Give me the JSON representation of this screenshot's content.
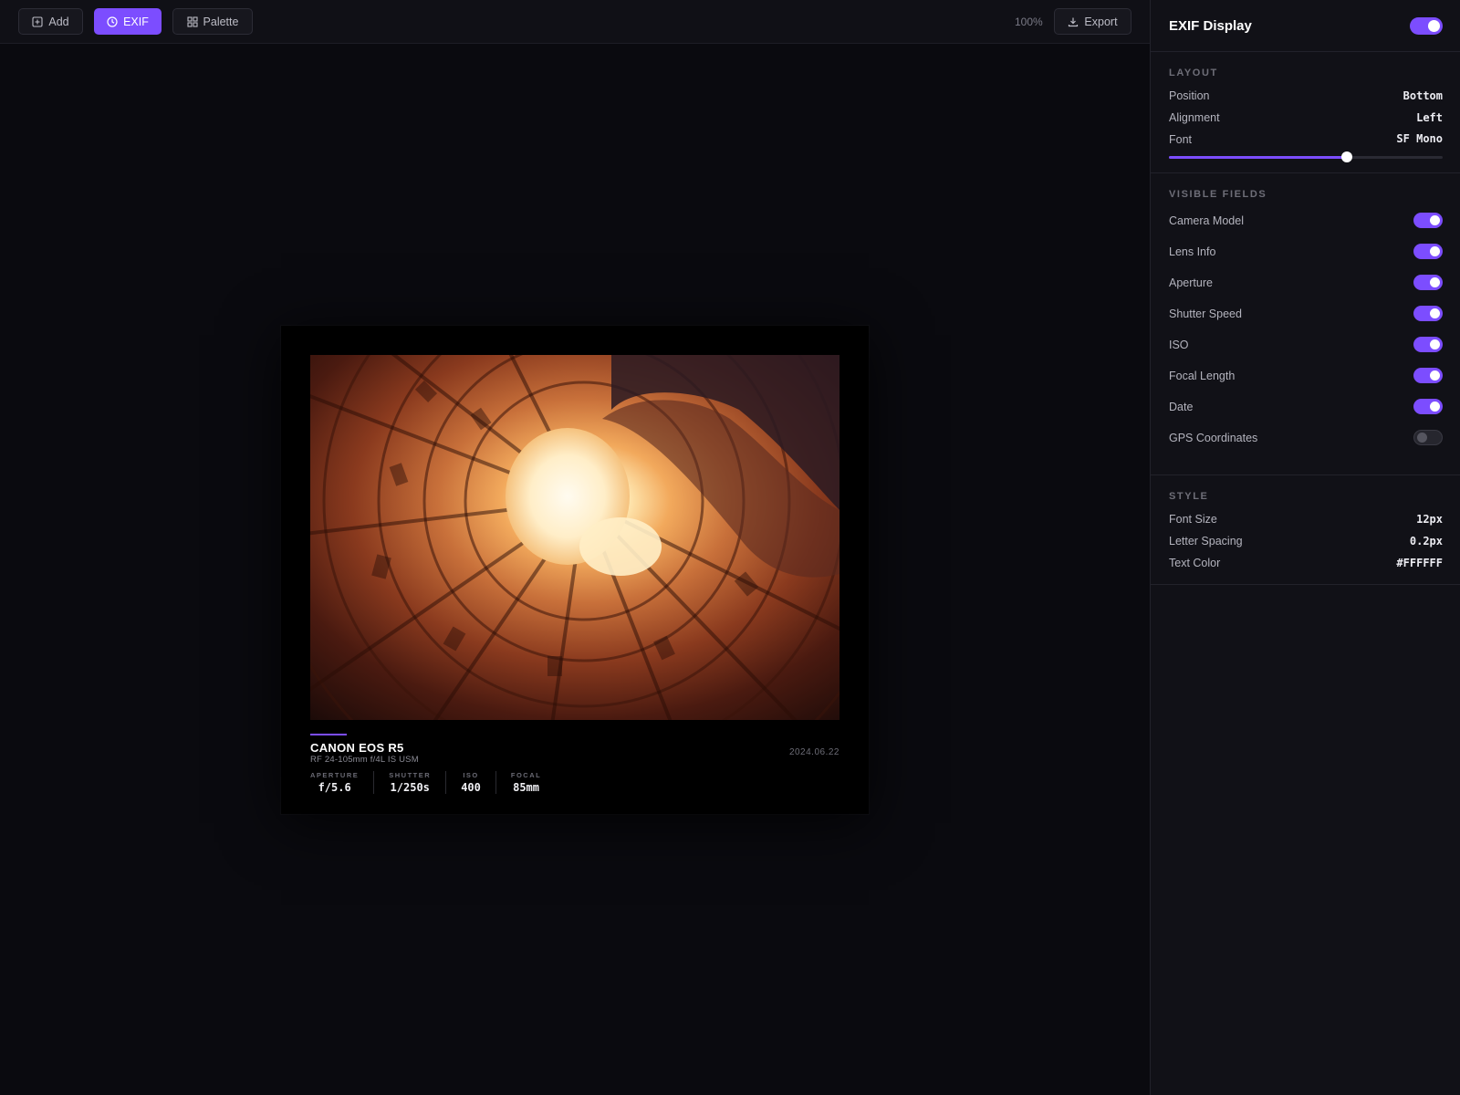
{
  "toolbar": {
    "add_label": "Add",
    "exif_label": "EXIF",
    "palette_label": "Palette",
    "zoom": "100%",
    "export_label": "Export"
  },
  "card": {
    "camera": "CANON EOS R5",
    "lens": "RF 24-105mm f/4L IS USM",
    "date": "2024.06.22",
    "stats": [
      {
        "label": "APERTURE",
        "value": "f/5.6"
      },
      {
        "label": "SHUTTER",
        "value": "1/250s"
      },
      {
        "label": "ISO",
        "value": "400"
      },
      {
        "label": "FOCAL",
        "value": "85mm"
      }
    ]
  },
  "sidebar": {
    "title": "EXIF Display",
    "enabled": true,
    "layout": {
      "title": "LAYOUT",
      "position_label": "Position",
      "position_value": "Bottom",
      "alignment_label": "Alignment",
      "alignment_value": "Left",
      "font_label": "Font",
      "font_value": "SF Mono",
      "slider_fraction": 0.65
    },
    "fields": {
      "title": "VISIBLE FIELDS",
      "items": [
        {
          "label": "Camera Model",
          "on": true
        },
        {
          "label": "Lens Info",
          "on": true
        },
        {
          "label": "Aperture",
          "on": true
        },
        {
          "label": "Shutter Speed",
          "on": true
        },
        {
          "label": "ISO",
          "on": true
        },
        {
          "label": "Focal Length",
          "on": true
        },
        {
          "label": "Date",
          "on": true
        },
        {
          "label": "GPS Coordinates",
          "on": false
        }
      ]
    },
    "style": {
      "title": "STYLE",
      "font_size_label": "Font Size",
      "font_size_value": "12px",
      "letter_spacing_label": "Letter Spacing",
      "letter_spacing_value": "0.2px",
      "text_color_label": "Text Color",
      "text_color_value": "#FFFFFF"
    }
  },
  "colors": {
    "accent": "#7c4dff",
    "background": "#0a0a0f",
    "panel": "#111117"
  }
}
